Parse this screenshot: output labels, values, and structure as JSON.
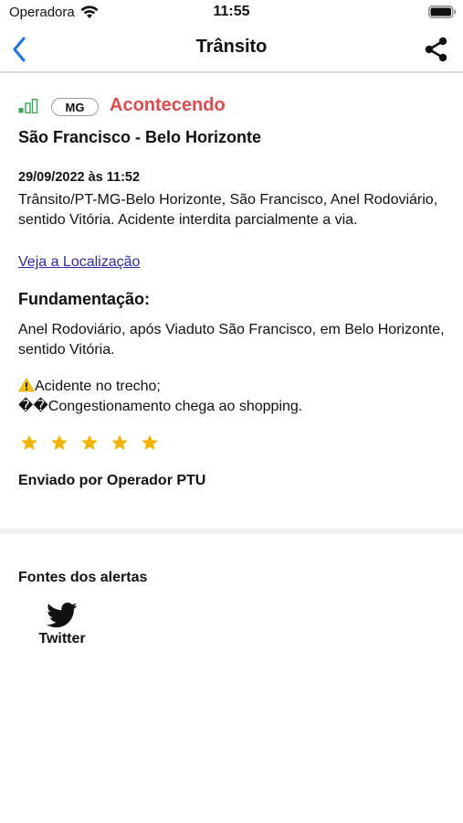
{
  "status_bar": {
    "carrier": "Operadora",
    "time": "11:55",
    "icons": [
      "wifi-icon",
      "battery-icon"
    ]
  },
  "nav": {
    "title": "Trânsito",
    "back_icon": "chevron-left-icon",
    "share_icon": "share-icon",
    "accent_color": "#1a73e8"
  },
  "alert": {
    "signal_icon": "signal-bars-icon",
    "state": "MG",
    "status": "Acontecendo",
    "status_color": "#e5484d",
    "route": "São Francisco - Belo Horizonte",
    "datetime": "29/09/2022 às 11:52",
    "description": "Trânsito/PT-MG-Belo Horizonte, São Francisco, Anel Rodoviário, sentido Vitória. Acidente interdita parcialmente a via.",
    "location_link": "Veja a Localização",
    "fundamentacao_title": "Fundamentação:",
    "fundamentacao_text": "Anel Rodoviário, após Viaduto São Francisco, em Belo Horizonte, sentido Vitória.",
    "note_line1": "Acidente no trecho;",
    "note_line2_prefix": "��",
    "note_line2": "Congestionamento chega ao shopping.",
    "rating": 5,
    "rating_max": 5,
    "star_color": "#f5b400",
    "sender": "Enviado por Operador PTU"
  },
  "sources": {
    "title": "Fontes dos alertas",
    "items": [
      {
        "label": "Twitter",
        "icon": "twitter-icon"
      }
    ]
  }
}
